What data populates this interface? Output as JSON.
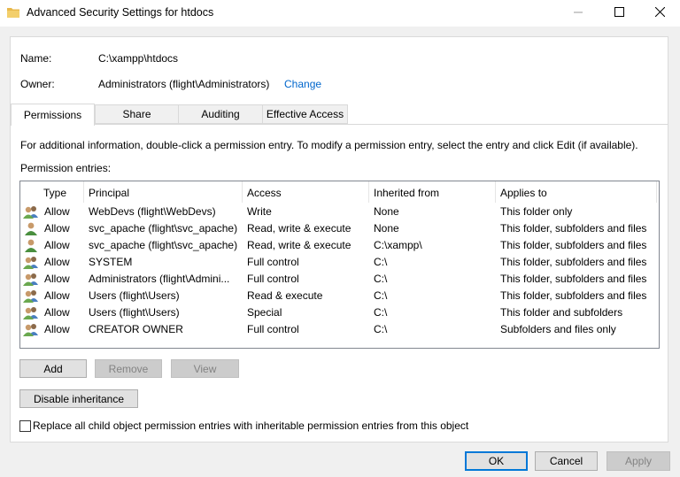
{
  "window": {
    "title": "Advanced Security Settings for htdocs"
  },
  "info": {
    "name_label": "Name:",
    "name_value": "C:\\xampp\\htdocs",
    "owner_label": "Owner:",
    "owner_value": "Administrators (flight\\Administrators)",
    "change_link": "Change"
  },
  "tabs": [
    "Permissions",
    "Share",
    "Auditing",
    "Effective Access"
  ],
  "description": "For additional information, double-click a permission entry. To modify a permission entry, select the entry and click Edit (if available).",
  "entries_label": "Permission entries:",
  "columns": [
    "Type",
    "Principal",
    "Access",
    "Inherited from",
    "Applies to"
  ],
  "rows": [
    {
      "icon": "group-icon",
      "type": "Allow",
      "principal": "WebDevs (flight\\WebDevs)",
      "access": "Write",
      "inherited": "None",
      "applies": "This folder only"
    },
    {
      "icon": "user-icon",
      "type": "Allow",
      "principal": "svc_apache (flight\\svc_apache)",
      "access": "Read, write & execute",
      "inherited": "None",
      "applies": "This folder, subfolders and files"
    },
    {
      "icon": "user-icon",
      "type": "Allow",
      "principal": "svc_apache (flight\\svc_apache)",
      "access": "Read, write & execute",
      "inherited": "C:\\xampp\\",
      "applies": "This folder, subfolders and files"
    },
    {
      "icon": "group-icon",
      "type": "Allow",
      "principal": "SYSTEM",
      "access": "Full control",
      "inherited": "C:\\",
      "applies": "This folder, subfolders and files"
    },
    {
      "icon": "group-icon",
      "type": "Allow",
      "principal": "Administrators (flight\\Admini...",
      "access": "Full control",
      "inherited": "C:\\",
      "applies": "This folder, subfolders and files"
    },
    {
      "icon": "group-icon",
      "type": "Allow",
      "principal": "Users (flight\\Users)",
      "access": "Read & execute",
      "inherited": "C:\\",
      "applies": "This folder, subfolders and files"
    },
    {
      "icon": "group-icon",
      "type": "Allow",
      "principal": "Users (flight\\Users)",
      "access": "Special",
      "inherited": "C:\\",
      "applies": "This folder and subfolders"
    },
    {
      "icon": "group-icon",
      "type": "Allow",
      "principal": "CREATOR OWNER",
      "access": "Full control",
      "inherited": "C:\\",
      "applies": "Subfolders and files only"
    }
  ],
  "buttons": {
    "add": "Add",
    "remove": "Remove",
    "view": "View",
    "disable_inheritance": "Disable inheritance",
    "ok": "OK",
    "cancel": "Cancel",
    "apply": "Apply"
  },
  "replace_checkbox_label": "Replace all child object permission entries with inheritable permission entries from this object",
  "colors": {
    "accent": "#0078d7",
    "link": "#0066cc",
    "folder": "#e8b84a"
  }
}
